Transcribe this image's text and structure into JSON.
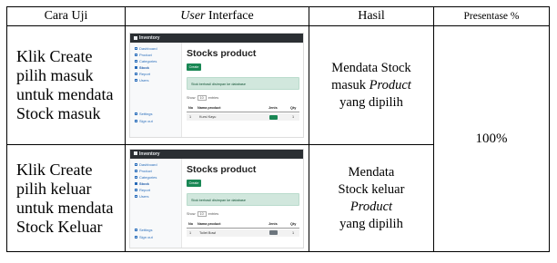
{
  "table": {
    "headers": {
      "test_method": "Cara Uji",
      "ui_italic": "User",
      "ui_rest": " Interface",
      "result": "Hasil",
      "percentage": "Presentase %"
    },
    "rows": [
      {
        "step_lines": [
          "Klik Create",
          "pilih masuk",
          "untuk mendata",
          "Stock masuk"
        ],
        "result": {
          "line1": "Mendata Stock",
          "line2_prefix": "masuk ",
          "line2_italic": "Product",
          "line3": "yang dipilih"
        },
        "screenshot": {
          "brand": "Inventory",
          "nav": [
            "Dashboard",
            "Product",
            "Categories",
            "Stock",
            "Report",
            "Users",
            "Settings",
            "Sign out"
          ],
          "active_index": 3,
          "title": "Stocks product",
          "create_label": "Create",
          "alert": "Stok berhasil disimpan ke database",
          "show_label": "Show",
          "show_value": "10",
          "entries_label": "entries",
          "columns": [
            "No",
            "Nama product",
            "Jenis",
            "Qty"
          ],
          "row": [
            "1",
            "Kursi Kayu",
            "",
            "1"
          ],
          "badge": "green"
        }
      },
      {
        "step_lines": [
          "Klik Create",
          "pilih keluar",
          "untuk mendata",
          "Stock Keluar"
        ],
        "result": {
          "line1": "Mendata",
          "line2": "Stock keluar",
          "line3_italic": "Product",
          "line4": "yang dipilih"
        },
        "screenshot": {
          "brand": "Inventory",
          "nav": [
            "Dashboard",
            "Product",
            "Categories",
            "Stock",
            "Report",
            "Users",
            "Settings",
            "Sign out"
          ],
          "active_index": 3,
          "title": "Stocks product",
          "create_label": "Create",
          "alert": "Stok berhasil disimpan ke database",
          "show_label": "Show",
          "show_value": "10",
          "entries_label": "entries",
          "columns": [
            "No",
            "Nama product",
            "Jenis",
            "Qty"
          ],
          "row": [
            "1",
            "Toilet Bowl",
            "",
            "1"
          ],
          "badge": "gray"
        }
      }
    ],
    "percentage_value": "100%"
  }
}
